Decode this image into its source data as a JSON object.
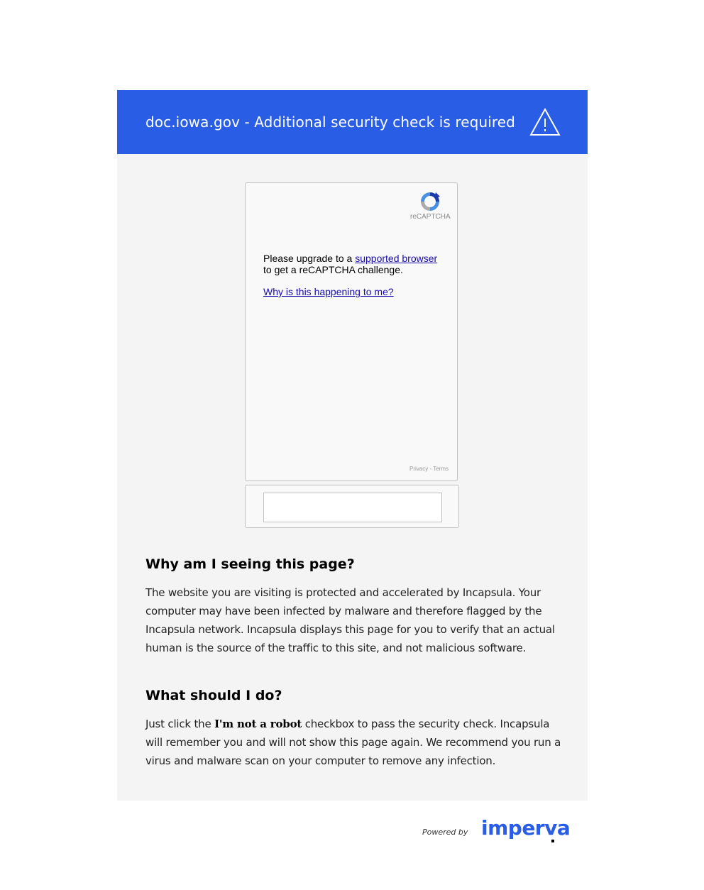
{
  "banner": {
    "title": "doc.iowa.gov - Additional security check is required",
    "icon": "warning-triangle-icon",
    "color": "#2a5de5"
  },
  "recaptcha": {
    "brand": "reCAPTCHA",
    "message_prefix": "Please upgrade to a ",
    "message_link": "supported browser",
    "message_suffix": "to get a reCAPTCHA challenge.",
    "why_link": "Why is this happening to me?",
    "footer_privacy": "Privacy",
    "footer_sep": " - ",
    "footer_terms": "Terms"
  },
  "why": {
    "heading": "Why am I seeing this page?",
    "body": "The website you are visiting is protected and accelerated by Incapsula. Your computer may have been infected by malware and therefore flagged by the Incapsula network. Incapsula displays this page for you to verify that an actual human is the source of the traffic to this site, and not malicious software."
  },
  "what": {
    "heading": "What should I do?",
    "body_prefix": "Just click the ",
    "body_bold": "I'm not a robot",
    "body_suffix": " checkbox to pass the security check. Incapsula will remember you and will not show this page again. We recommend you run a virus and malware scan on your computer to remove any infection."
  },
  "footer": {
    "powered_by": "Powered by",
    "brand": "imperva",
    "brand_color": "#2a5de5"
  }
}
